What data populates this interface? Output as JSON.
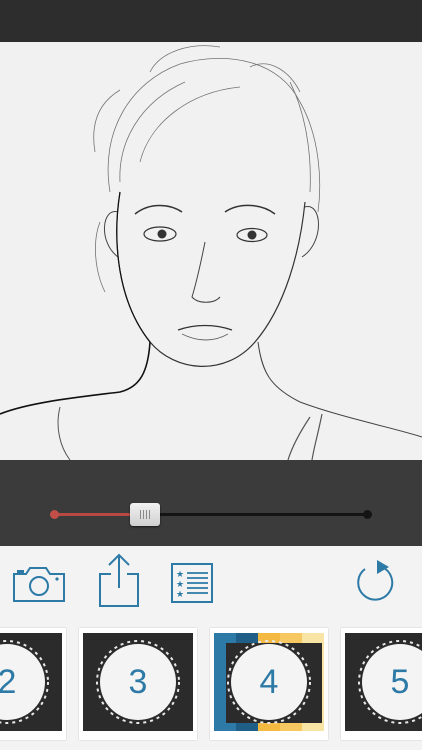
{
  "colors": {
    "accent": "#2d7aa7",
    "slider_fill": "#b94a43",
    "top_bar": "#2d2d2d",
    "slider_bg": "#3b3b3b"
  },
  "slider": {
    "value_fraction": 0.29
  },
  "toolbar": {
    "camera": "camera-icon",
    "share": "share-icon",
    "list": "list-icon",
    "refresh": "refresh-icon"
  },
  "filters": [
    {
      "label": "2",
      "selected": false
    },
    {
      "label": "3",
      "selected": false
    },
    {
      "label": "4",
      "selected": true
    },
    {
      "label": "5",
      "selected": false
    }
  ]
}
